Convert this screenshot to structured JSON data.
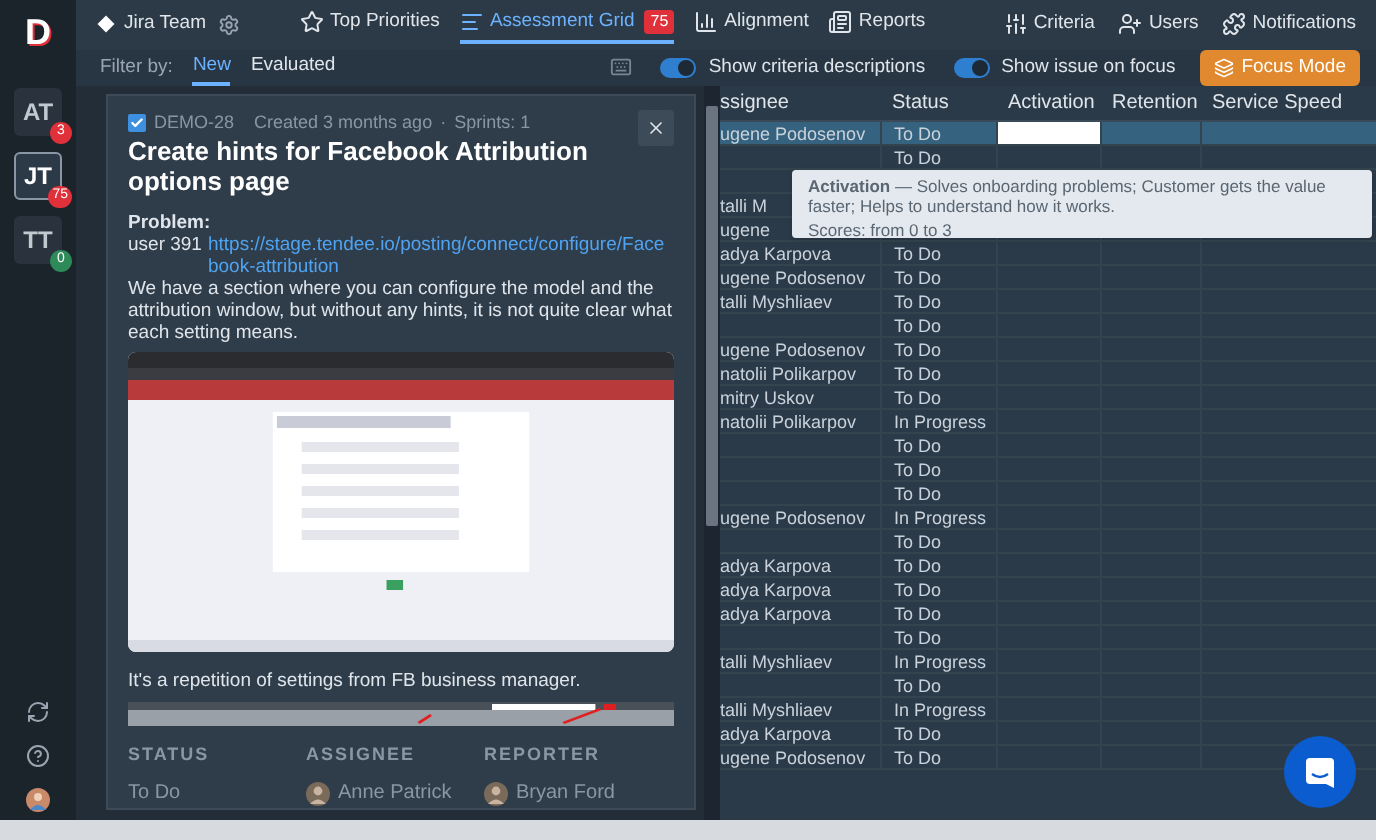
{
  "logo": "D",
  "workspace": "Jira Team",
  "nav": [
    {
      "label": "Top Priorities",
      "kind": "star",
      "selected": false
    },
    {
      "label": "Assessment Grid",
      "kind": "grid",
      "selected": true,
      "badge": "75"
    },
    {
      "label": "Alignment",
      "kind": "bars",
      "selected": false
    },
    {
      "label": "Reports",
      "kind": "report",
      "selected": false
    }
  ],
  "nav_right": [
    {
      "label": "Criteria",
      "kind": "sliders"
    },
    {
      "label": "Users",
      "kind": "users"
    },
    {
      "label": "Notifications",
      "kind": "puzzle"
    }
  ],
  "teams": [
    {
      "label": "AT",
      "badge": "3",
      "color": "#e0303a",
      "selected": false
    },
    {
      "label": "JT",
      "badge": "75",
      "color": "#e0303a",
      "selected": true
    },
    {
      "label": "TT",
      "badge": "0",
      "color": "#2f8a5a",
      "selected": false
    }
  ],
  "filter": {
    "label": "Filter by:",
    "tabs": [
      {
        "label": "New",
        "selected": true
      },
      {
        "label": "Evaluated",
        "selected": false
      }
    ]
  },
  "toggles": [
    {
      "label": "Show criteria descriptions",
      "on": true
    },
    {
      "label": "Show issue on focus",
      "on": true
    }
  ],
  "focus_button": "Focus Mode",
  "issue": {
    "checked": true,
    "key": "DEMO-28",
    "created": "Created 3 months ago",
    "separator": "·",
    "sprints": "Sprints: 1",
    "title": "Create hints for Facebook Attribution options page",
    "problem_label": "Problem:",
    "user": "user 391",
    "link": "https://stage.tendee.io/posting/connect/configure/Facebook-attribution",
    "paragraph": "We have a section where you can configure the model and the attribution window, but without any hints, it is not quite clear what each setting means.",
    "paragraph2": "It's a repetition of settings from FB business manager.",
    "fields": [
      {
        "label": "STATUS",
        "value": "To Do",
        "kind": "text"
      },
      {
        "label": "ASSIGNEE",
        "value": "Anne Patrick",
        "kind": "person"
      },
      {
        "label": "REPORTER",
        "value": "Bryan Ford",
        "kind": "person"
      }
    ]
  },
  "table": {
    "columns": [
      "ssignee",
      "Status",
      "Activation",
      "Retention",
      "Service Speed"
    ],
    "rows": [
      {
        "assignee": "ugene Podosenov",
        "status": "To Do",
        "selected": true
      },
      {
        "status": "To Do",
        "selected": false
      },
      {
        "selected": false
      },
      {
        "assignee": "talli M",
        "selected": false
      },
      {
        "assignee": "ugene",
        "selected": false
      },
      {
        "assignee": "adya Karpova",
        "status": "To Do",
        "selected": false
      },
      {
        "assignee": "ugene Podosenov",
        "status": "To Do",
        "selected": false
      },
      {
        "assignee": "talli Myshliaev",
        "status": "To Do",
        "selected": false
      },
      {
        "status": "To Do",
        "selected": false
      },
      {
        "assignee": "ugene Podosenov",
        "status": "To Do",
        "selected": false
      },
      {
        "assignee": "natolii Polikarpov",
        "status": "To Do",
        "selected": false
      },
      {
        "assignee": "mitry Uskov",
        "status": "To Do",
        "selected": false
      },
      {
        "assignee": "natolii Polikarpov",
        "status": "In Progress",
        "selected": false
      },
      {
        "status": "To Do",
        "selected": false
      },
      {
        "status": "To Do",
        "selected": false
      },
      {
        "status": "To Do",
        "selected": false
      },
      {
        "assignee": "ugene Podosenov",
        "status": "In Progress",
        "selected": false
      },
      {
        "status": "To Do",
        "selected": false
      },
      {
        "assignee": "adya Karpova",
        "status": "To Do",
        "selected": false
      },
      {
        "assignee": "adya Karpova",
        "status": "To Do",
        "selected": false
      },
      {
        "assignee": "adya Karpova",
        "status": "To Do",
        "selected": false
      },
      {
        "status": "To Do",
        "selected": false
      },
      {
        "assignee": "talli Myshliaev",
        "status": "In Progress",
        "selected": false
      },
      {
        "status": "To Do",
        "selected": false
      },
      {
        "assignee": "talli Myshliaev",
        "status": "In Progress",
        "selected": false
      },
      {
        "assignee": "adya Karpova",
        "status": "To Do",
        "selected": false
      },
      {
        "assignee": "ugene Podosenov",
        "status": "To Do",
        "selected": false
      }
    ]
  },
  "tooltip": {
    "text": "**Activation** — Solves onboarding problems; Customer gets the value faster; Helps to understand how it works.",
    "scores": "Scores: from 0 to 3"
  }
}
